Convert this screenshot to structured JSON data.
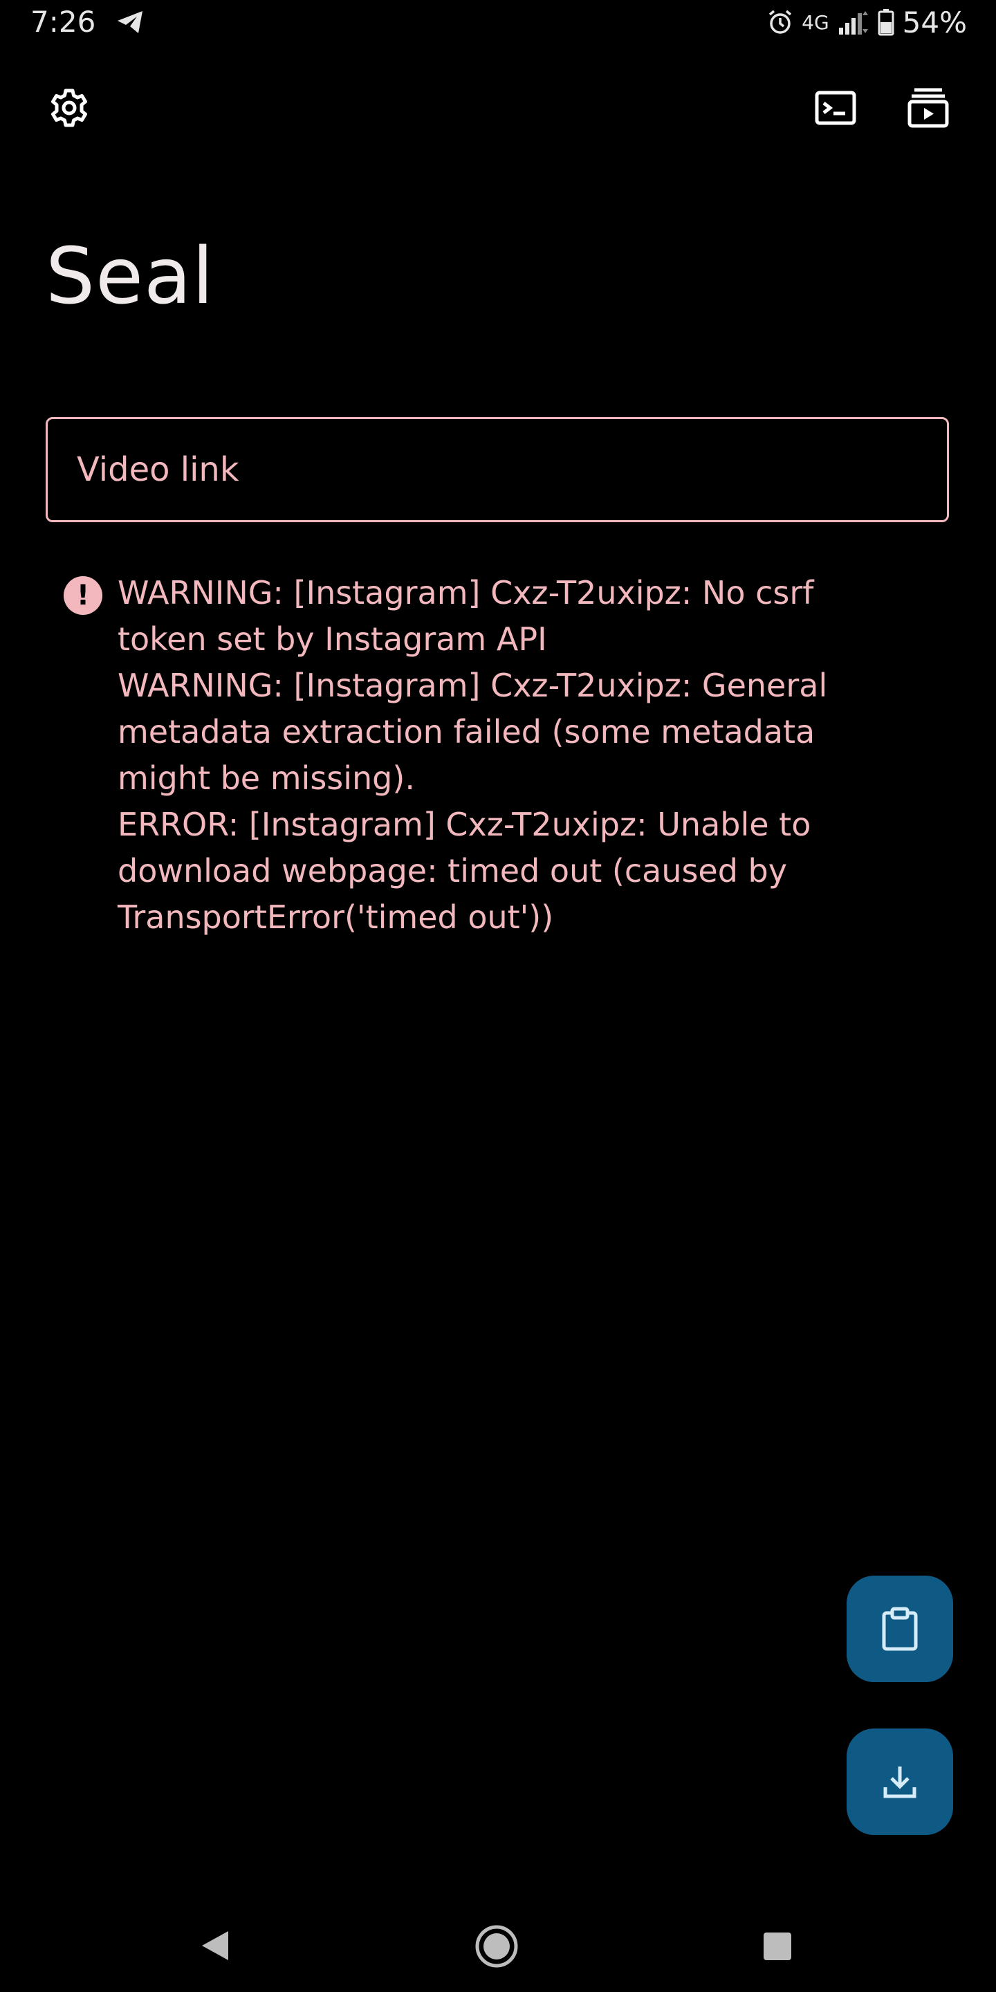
{
  "status_bar": {
    "time": "7:26",
    "network": "4G",
    "battery": "54%",
    "icons": [
      "telegram-icon",
      "alarm-icon",
      "signal-icon",
      "battery-icon"
    ]
  },
  "app_bar": {
    "icons": [
      "gear-icon",
      "terminal-icon",
      "download-queue-icon"
    ]
  },
  "title": "Seal",
  "link_input": {
    "placeholder": "Video link",
    "value": ""
  },
  "error": {
    "icon": "error-icon",
    "lines": [
      "WARNING: [Instagram] Cxz-T2uxipz: No csrf",
      "token set by Instagram API",
      "WARNING: [Instagram] Cxz-T2uxipz: General",
      "metadata extraction failed (some metadata",
      "might be missing).",
      "ERROR: [Instagram] Cxz-T2uxipz: Unable to",
      "download webpage: timed out (caused by",
      "TransportError('timed out'))"
    ],
    "error_icon_glyph": "!"
  },
  "fabs": {
    "icons": [
      "clipboard-icon",
      "download-icon"
    ]
  },
  "nav_bar": {
    "icons": [
      "back-icon",
      "home-icon",
      "recents-icon"
    ]
  },
  "colors": {
    "background": "#000000",
    "accent_pink": "#f2b8bd",
    "fab_blue": "#0e5a85",
    "fab_icon": "#d6ecf8",
    "text_light": "#f0eaea"
  }
}
